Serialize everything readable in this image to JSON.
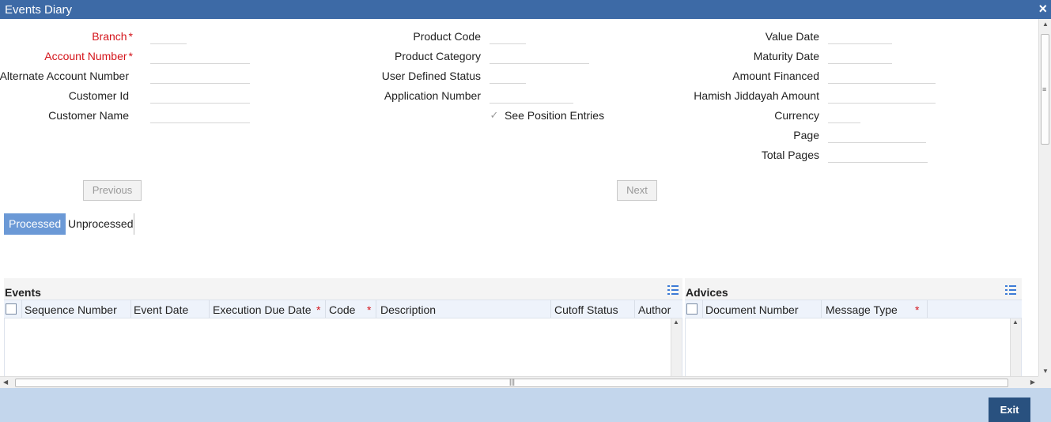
{
  "window": {
    "title": "Events Diary",
    "close_icon": "×"
  },
  "form": {
    "col1": {
      "branch": "Branch",
      "account_number": "Account Number",
      "alternate_account_number": "Alternate Account Number",
      "customer_id": "Customer Id",
      "customer_name": "Customer Name",
      "required_marker": "*"
    },
    "col2": {
      "product_code": "Product Code",
      "product_category": "Product Category",
      "user_defined_status": "User Defined Status",
      "application_number": "Application Number",
      "see_position_entries": "See Position Entries",
      "see_position_entries_checked": true
    },
    "col3": {
      "value_date": "Value Date",
      "maturity_date": "Maturity Date",
      "amount_financed": "Amount Financed",
      "hamish_jiddayah_amount": "Hamish Jiddayah Amount",
      "currency": "Currency",
      "page": "Page",
      "total_pages": "Total Pages"
    }
  },
  "navigation": {
    "previous": "Previous",
    "next": "Next"
  },
  "tabs": [
    {
      "label": "Processed",
      "active": true
    },
    {
      "label": "Unprocessed",
      "active": false
    }
  ],
  "events_panel": {
    "title": "Events",
    "columns": [
      "Sequence Number",
      "Event Date",
      "Execution Due Date",
      "Code",
      "Description",
      "Cutoff Status",
      "Author"
    ],
    "required_marker": "*"
  },
  "advices_panel": {
    "title": "Advices",
    "columns": [
      "Document Number",
      "Message Type"
    ],
    "required_marker": "*"
  },
  "footer": {
    "exit": "Exit"
  },
  "colors": {
    "titlebar": "#3d6aa6",
    "active_tab": "#6b99d6",
    "required": "#d4141b",
    "footer": "#c3d6ec",
    "exit_button": "#29517f"
  },
  "icons": {
    "list_icon": "list-icon",
    "check_icon": "✓",
    "scroll_up": "▲",
    "scroll_down": "▼",
    "scroll_left": "◀",
    "scroll_right": "▶",
    "grip": "≡",
    "grip_h": "|||"
  }
}
